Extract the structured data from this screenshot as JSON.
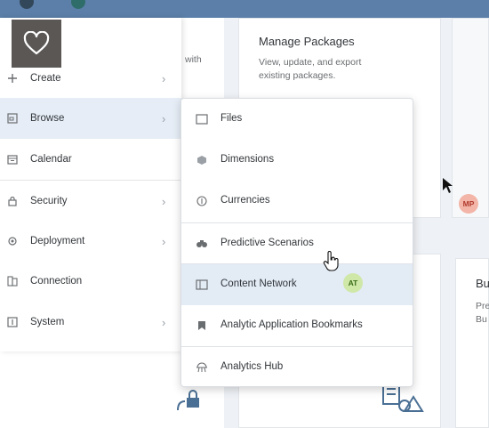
{
  "cards": {
    "manage_packages": {
      "title": "Manage Packages",
      "desc1": "View, update, and export",
      "desc2": "existing packages."
    },
    "partial_left": {
      "text": "with"
    },
    "partial_right": {
      "title": "Bu",
      "desc1": "Pre",
      "desc2": "Bu"
    }
  },
  "sidebar": {
    "items": [
      {
        "label": "Create",
        "icon": "plus-icon",
        "has_submenu": true
      },
      {
        "label": "Browse",
        "icon": "folder-icon",
        "has_submenu": true,
        "active": true
      },
      {
        "label": "Calendar",
        "icon": "calendar-icon",
        "has_submenu": false
      },
      {
        "label": "Security",
        "icon": "lock-icon",
        "has_submenu": true
      },
      {
        "label": "Deployment",
        "icon": "deployment-icon",
        "has_submenu": true
      },
      {
        "label": "Connection",
        "icon": "connection-icon",
        "has_submenu": false
      },
      {
        "label": "System",
        "icon": "system-icon",
        "has_submenu": true
      }
    ],
    "chevron": "›"
  },
  "submenu": {
    "items": [
      {
        "label": "Files",
        "icon": "file-icon"
      },
      {
        "label": "Dimensions",
        "icon": "cube-icon"
      },
      {
        "label": "Currencies",
        "icon": "currency-icon"
      },
      {
        "label": "Predictive Scenarios",
        "icon": "binoculars-icon"
      },
      {
        "label": "Content Network",
        "icon": "content-network-icon",
        "hovered": true
      },
      {
        "label": "Analytic Application Bookmarks",
        "icon": "bookmark-icon"
      },
      {
        "label": "Analytics Hub",
        "icon": "analytics-hub-icon"
      }
    ]
  },
  "avatars": {
    "mp": {
      "initials": "MP",
      "bg": "#f3b5a7",
      "fg": "#b03a2e"
    },
    "at": {
      "initials": "AT",
      "bg": "#cfe8a8",
      "fg": "#3b6b16"
    }
  },
  "colors": {
    "topbar": "#5b7fa8",
    "active_bg": "#e6edf6",
    "hover_bg": "#e3ebf5",
    "heart_badge": "#5a5755"
  }
}
